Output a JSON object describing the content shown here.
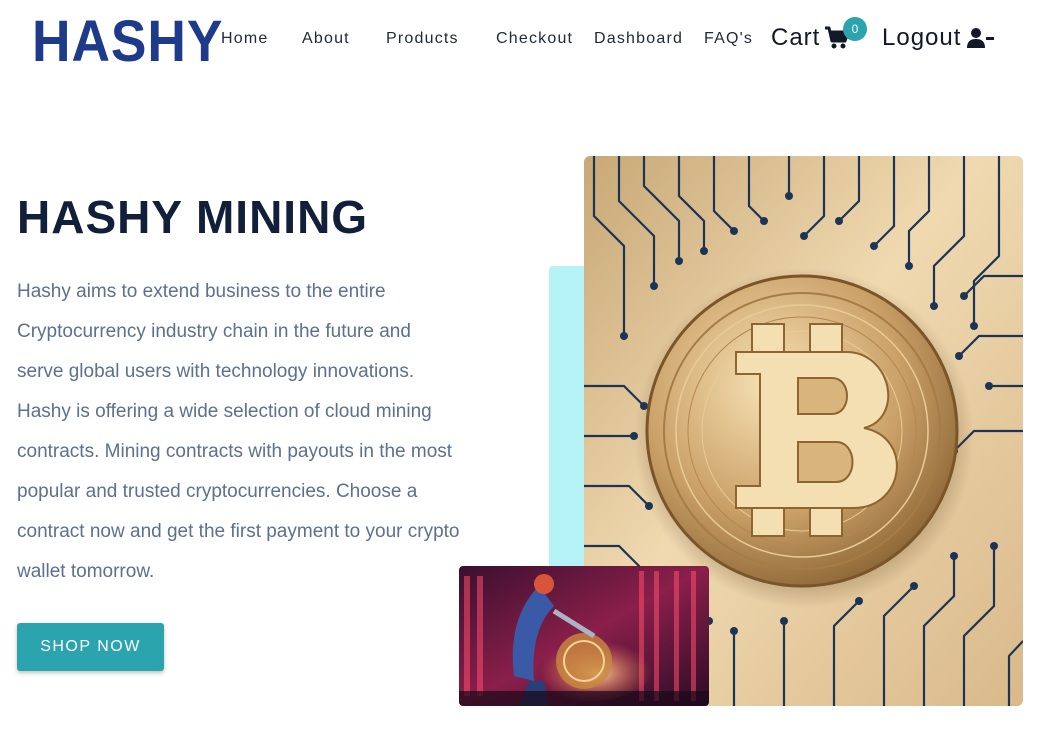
{
  "nav": {
    "logo": "HASHY",
    "links": [
      "Home",
      "About",
      "Products",
      "Checkout",
      "Dashboard",
      "FAQ's"
    ],
    "cart_label": "Cart",
    "cart_count": "0",
    "logout_label": "Logout"
  },
  "hero": {
    "title": "HASHY MINING",
    "description": "Hashy aims to extend business to the entire Cryptocurrency industry chain in the future and serve global users with technology innovations. Hashy is offering a wide selection of cloud mining contracts. Mining contracts with payouts in the most popular and trusted cryptocurrencies. Choose a contract now and get the first payment to your crypto wallet tomorrow.",
    "cta_label": "SHOP NOW"
  },
  "colors": {
    "brand": "#1e3a8a",
    "accent": "#2ba4ae",
    "accent_light": "#b5f3f7",
    "title": "#111f3a",
    "body_text": "#5b718d"
  },
  "icons": {
    "cart": "shopping-cart-icon",
    "logout": "user-minus-icon",
    "hero_image": "bitcoin-circuit-image",
    "secondary_image": "crypto-miner-image"
  }
}
